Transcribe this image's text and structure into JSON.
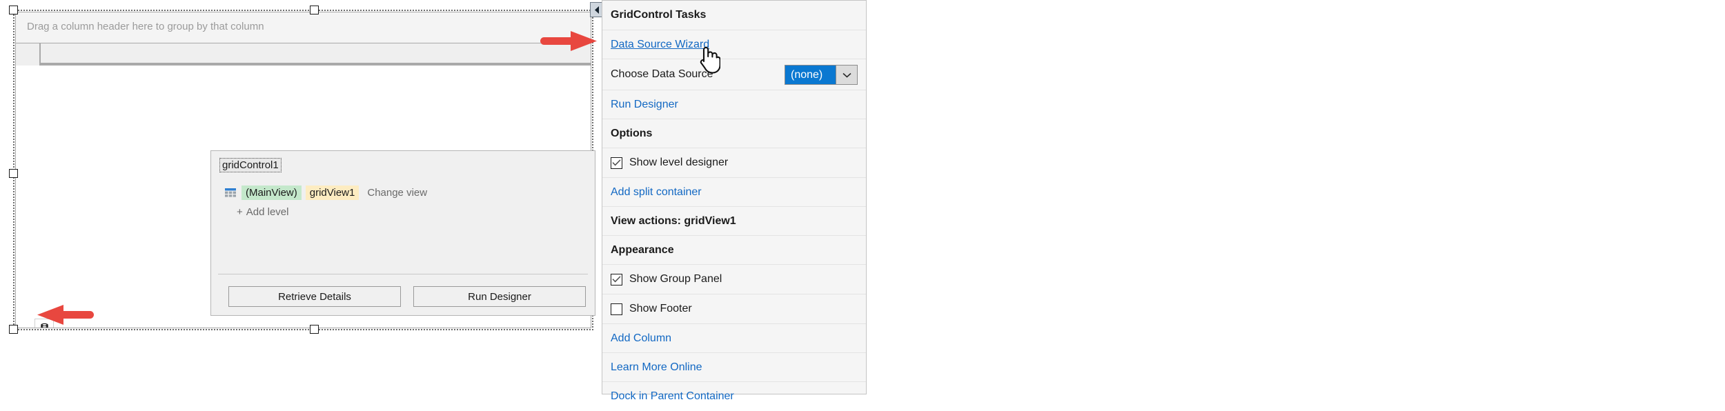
{
  "designer": {
    "grid": {
      "group_panel_text": "Drag a column header here to group by that column",
      "db_icon": "database-icon",
      "smarttag_icon": "smart-tag-arrow-icon"
    },
    "level_designer": {
      "control_name": "gridControl1",
      "view_icon": "grid-view-icon",
      "main_view_chip": "(MainView)",
      "view_name_chip": "gridView1",
      "change_view_label": "Change view",
      "add_level_plus": "+",
      "add_level_label": "Add level",
      "retrieve_details_label": "Retrieve Details",
      "run_designer_label": "Run Designer"
    }
  },
  "task_panel": {
    "title": "GridControl Tasks",
    "data_source_wizard": "Data Source Wizard",
    "choose_data_source_label": "Choose Data Source",
    "data_source_value": "(none)",
    "dropdown_icon": "chevron-down-icon",
    "run_designer": "Run Designer",
    "options_header": "Options",
    "show_level_designer": "Show level designer",
    "show_level_designer_checked": true,
    "add_split_container": "Add split container",
    "view_actions": "View actions: gridView1",
    "appearance_header": "Appearance",
    "show_group_panel": "Show Group Panel",
    "show_group_panel_checked": true,
    "show_footer": "Show Footer",
    "show_footer_checked": false,
    "add_column": "Add Column",
    "learn_more_online": "Learn More Online",
    "dock_in_parent_container": "Dock in Parent Container"
  },
  "annotations": {
    "arrow_color": "#e8473f",
    "arrow_to_wizard": "red-arrow-right-icon",
    "arrow_to_datasource_icon": "red-arrow-left-icon"
  },
  "cursor": {
    "icon": "hand-pointer-cursor"
  }
}
